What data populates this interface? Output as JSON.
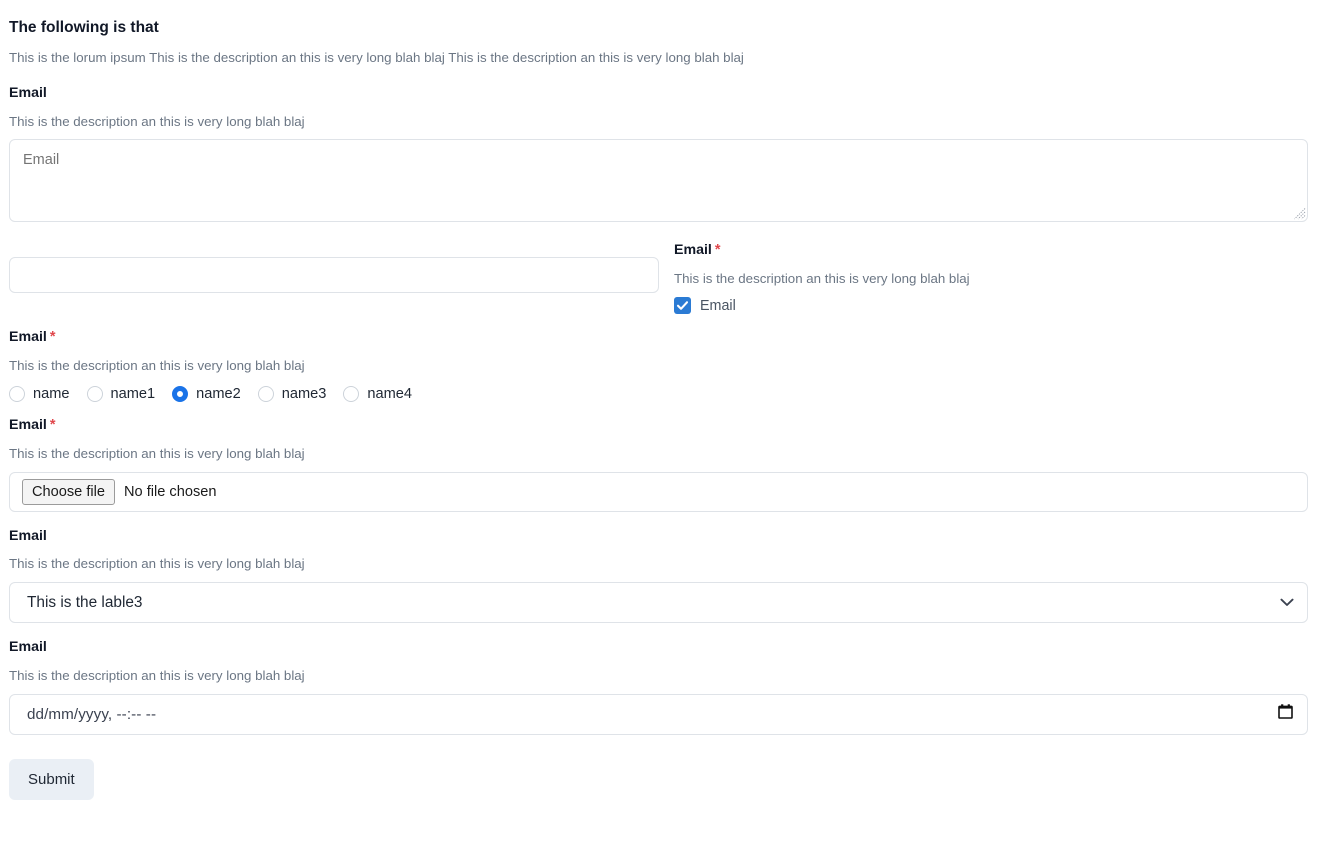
{
  "form": {
    "title": "The following is that",
    "subtitle": "This is the lorum ipsum This is the description an this is very long blah blaj This is the description an this is very long blah blaj",
    "submit_label": "Submit",
    "required_marker": "*"
  },
  "colors": {
    "accent_blue": "#1a73e8",
    "checkbox_blue": "#2b7bd4",
    "required_red": "#e0474c",
    "border": "#dfe3e8",
    "muted_text": "#6b7684",
    "submit_bg": "#eaeff5"
  },
  "fields": {
    "textarea": {
      "label": "Email",
      "description": "This is the description an this is very long blah blaj",
      "placeholder": "Email",
      "value": ""
    },
    "text_input": {
      "placeholder": "",
      "value": ""
    },
    "checkbox": {
      "label": "Email",
      "description": "This is the description an this is very long blah blaj",
      "option_label": "Email",
      "checked": true
    },
    "radio_group": {
      "label": "Email",
      "description": "This is the description an this is very long blah blaj",
      "options": [
        {
          "label": "name",
          "selected": false
        },
        {
          "label": "name1",
          "selected": false
        },
        {
          "label": "name2",
          "selected": true
        },
        {
          "label": "name3",
          "selected": false
        },
        {
          "label": "name4",
          "selected": false
        }
      ]
    },
    "file": {
      "label": "Email",
      "description": "This is the description an this is very long blah blaj",
      "button_label": "Choose file",
      "status": "No file chosen"
    },
    "select": {
      "label": "Email",
      "description": "This is the description an this is very long blah blaj",
      "selected": "This is the lable3"
    },
    "datetime": {
      "label": "Email",
      "description": "This is the description an this is very long blah blaj",
      "placeholder": "dd/mm/yyyy, --:-- --"
    }
  }
}
